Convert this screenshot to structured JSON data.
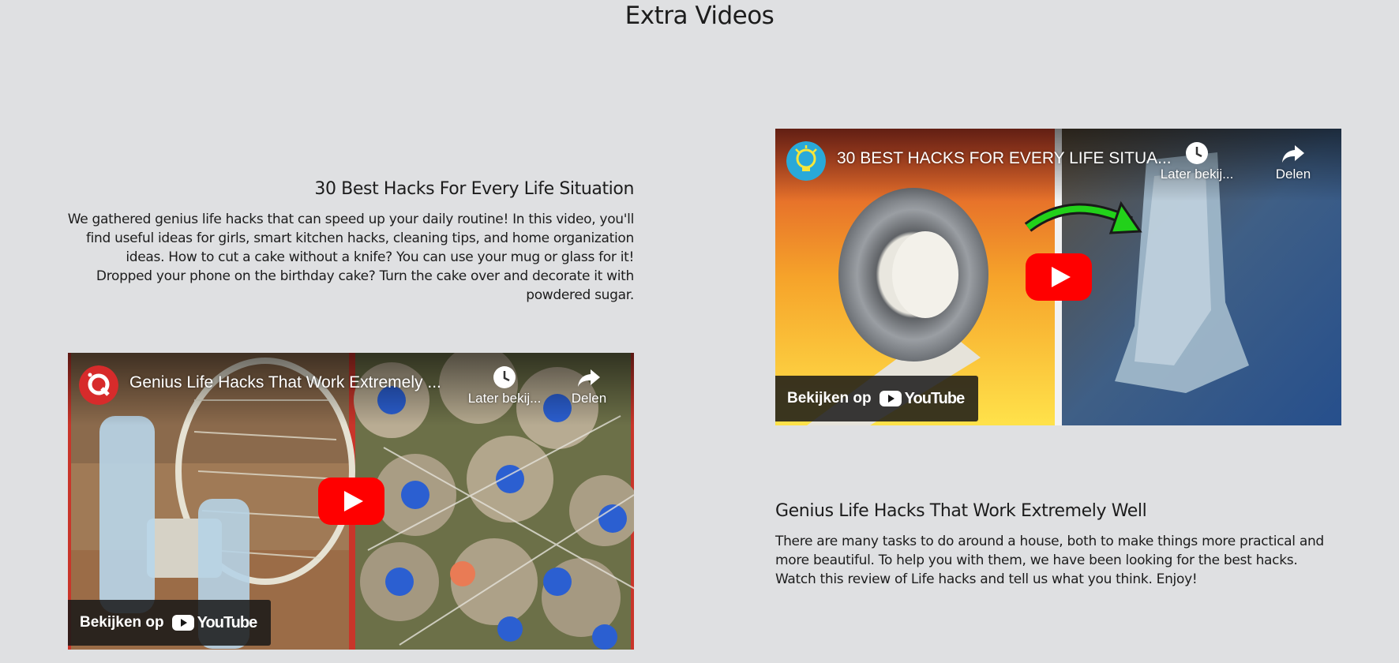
{
  "page": {
    "title": "Extra Videos"
  },
  "sections": [
    {
      "heading": "30 Best Hacks For Every Life Situation",
      "description_lines": [
        "We gathered genius life hacks that can speed up your daily routine! In this video, you'll",
        "find useful ideas for girls, smart kitchen hacks, cleaning tips, and home organization",
        "ideas. How to cut a cake without a knife? You can use your mug or glass for it!",
        "Dropped your phone on the birthday cake? Turn the cake over and decorate it with",
        "powdered sugar."
      ],
      "video": {
        "title": "30 BEST HACKS FOR EVERY LIFE SITUA...",
        "watch_later": "Later bekij...",
        "share": "Delen",
        "watch_on": "Bekijken op",
        "platform": "YouTube"
      }
    },
    {
      "heading": "Genius Life Hacks That Work Extremely Well",
      "description_lines": [
        "There are many tasks to do around a house, both to make things more practical and",
        "more beautiful. To help you with them, we have been looking for the best hacks.",
        "Watch this review of Life hacks and tell us what you think. Enjoy!"
      ],
      "video": {
        "title": "Genius Life Hacks That Work Extremely ...",
        "watch_later": "Later bekij...",
        "share": "Delen",
        "watch_on": "Bekijken op",
        "platform": "YouTube"
      }
    }
  ],
  "icons": {
    "play": "play-icon",
    "clock": "clock-icon",
    "share": "share-icon",
    "youtube_logo": "youtube-logo-icon",
    "channel_1": "lightbulb-channel-icon",
    "channel_2": "q-channel-icon"
  },
  "colors": {
    "background": "#dfe0e2",
    "youtube_red": "#ff0000",
    "text": "#1c1c1c"
  }
}
